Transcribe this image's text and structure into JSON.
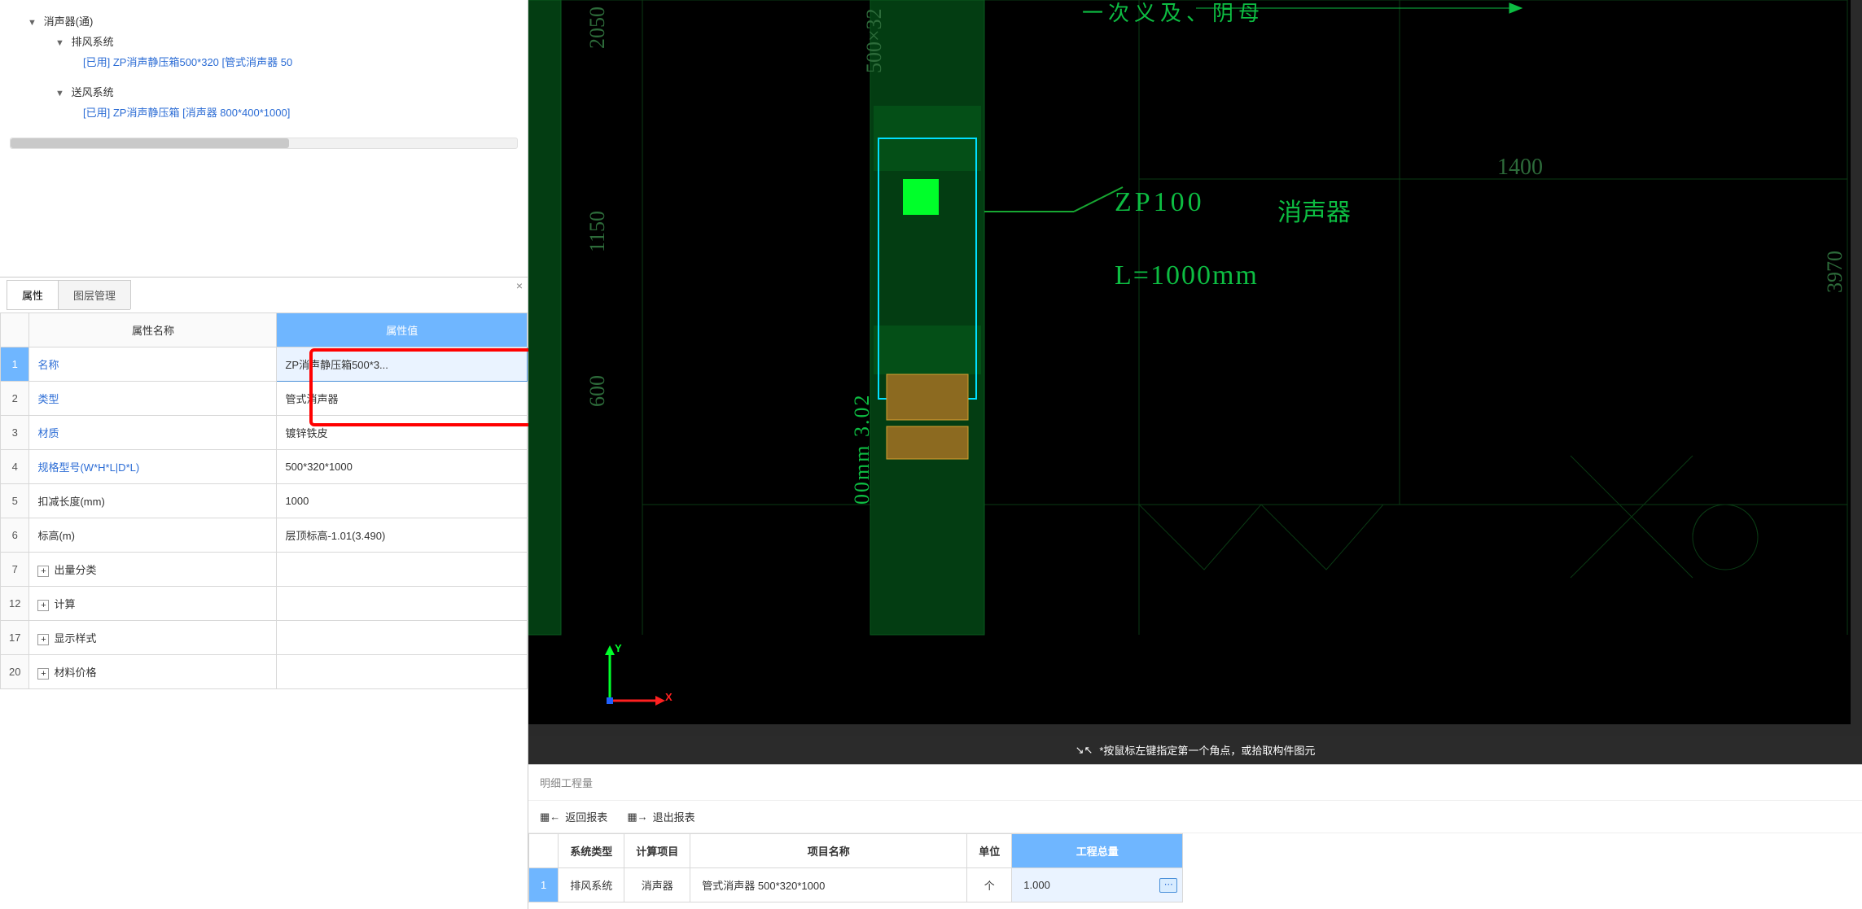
{
  "tree": {
    "root": "消声器(通)",
    "sys1": "排风系统",
    "sys1_item_prefix": "[已用]",
    "sys1_item": "ZP消声静压箱500*320 [管式消声器 50",
    "sys2": "送风系统",
    "sys2_item_prefix": "[已用]",
    "sys2_item": "ZP消声静压箱 [消声器 800*400*1000]"
  },
  "tabs": {
    "t1": "属性",
    "t2": "图层管理"
  },
  "prop": {
    "head_name": "属性名称",
    "head_val": "属性值",
    "rows": [
      {
        "n": "1",
        "name": "名称",
        "val": "ZP消声静压箱500*3...",
        "link": true
      },
      {
        "n": "2",
        "name": "类型",
        "val": "管式消声器",
        "link": true
      },
      {
        "n": "3",
        "name": "材质",
        "val": "镀锌铁皮",
        "link": true
      },
      {
        "n": "4",
        "name": "规格型号(W*H*L|D*L)",
        "val": "500*320*1000",
        "link": true
      },
      {
        "n": "5",
        "name": "扣减长度(mm)",
        "val": "1000",
        "link": false
      },
      {
        "n": "6",
        "name": "标高(m)",
        "val": "层顶标高-1.01(3.490)",
        "link": false
      },
      {
        "n": "7",
        "name": "出量分类",
        "val": "",
        "expand": true
      },
      {
        "n": "12",
        "name": "计算",
        "val": "",
        "expand": true
      },
      {
        "n": "17",
        "name": "显示样式",
        "val": "",
        "expand": true
      },
      {
        "n": "20",
        "name": "材料价格",
        "val": "",
        "expand": true
      }
    ]
  },
  "cad": {
    "dim_2050": "2050",
    "dim_1150": "1150",
    "dim_600": "600",
    "dim_500x32": "500×32",
    "dim_1400": "1400",
    "dim_3970": "3970",
    "zp100": "ZP100",
    "silencer": "消声器",
    "length": "L=1000mm",
    "vert_text": "00mm 3.02",
    "axis_y": "Y",
    "axis_x": "X",
    "top_annot": "一次义及、阴母"
  },
  "hint": "*按鼠标左键指定第一个角点，或拾取构件图元",
  "detail": {
    "title": "明细工程量",
    "tool1": "返回报表",
    "tool2": "退出报表",
    "head": {
      "c1": "系统类型",
      "c2": "计算项目",
      "c3": "项目名称",
      "c4": "单位",
      "c5": "工程总量"
    },
    "row": {
      "n": "1",
      "c1": "排风系统",
      "c2": "消声器",
      "c3": "管式消声器 500*320*1000",
      "c4": "个",
      "c5": "1.000"
    }
  }
}
